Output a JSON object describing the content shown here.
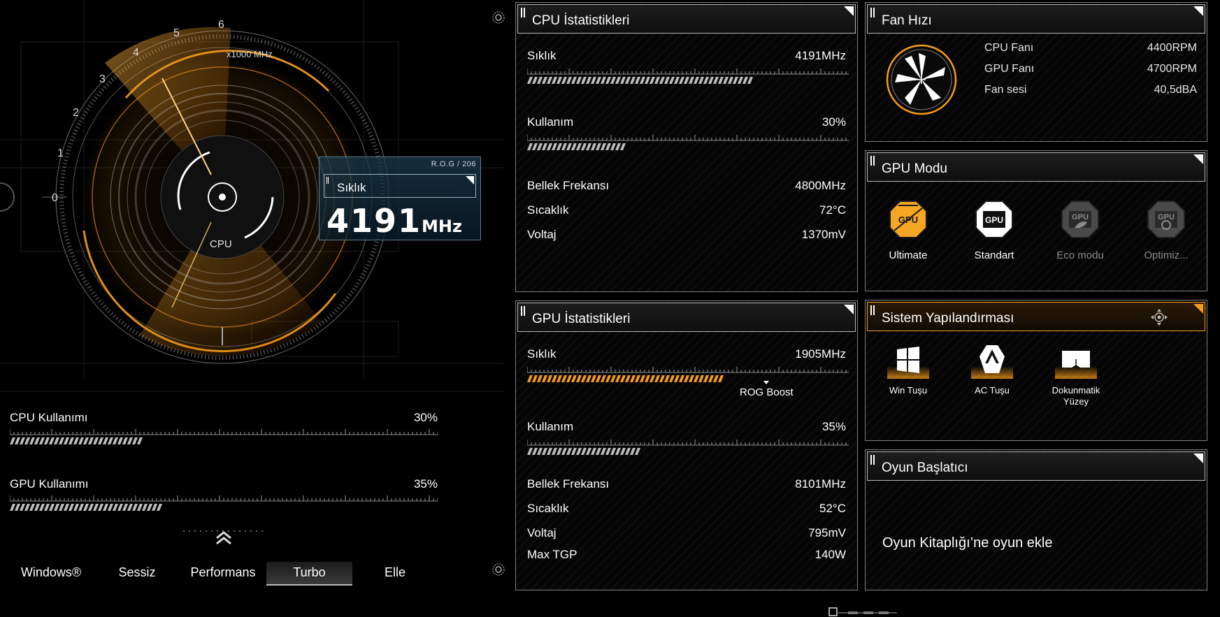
{
  "gauge": {
    "scale_label": "x1000 MHz",
    "ticks": [
      "0",
      "1",
      "2",
      "3",
      "4",
      "5",
      "6"
    ],
    "center_label": "CPU"
  },
  "freq_panel": {
    "badge": "R.O.G / 206",
    "label": "Sıklık",
    "value": "4191",
    "unit": "MHz"
  },
  "left_usage": [
    {
      "label": "CPU Kullanımı",
      "value": "30%",
      "fraction": 0.3
    },
    {
      "label": "GPU Kullanımı",
      "value": "35%",
      "fraction": 0.35
    }
  ],
  "modes": {
    "items": [
      "Windows®",
      "Sessiz",
      "Performans",
      "Turbo",
      "Elle"
    ],
    "active": "Turbo"
  },
  "cpu_stats": {
    "title": "CPU İstatistikleri",
    "freq": {
      "label": "Sıklık",
      "value": "4191MHz",
      "fraction": 0.7
    },
    "usage": {
      "label": "Kullanım",
      "value": "30%",
      "fraction": 0.3
    },
    "rows": [
      {
        "label": "Bellek Frekansı",
        "value": "4800MHz"
      },
      {
        "label": "Sıcaklık",
        "value": "72°C"
      },
      {
        "label": "Voltaj",
        "value": "1370mV"
      }
    ]
  },
  "gpu_stats": {
    "title": "GPU İstatistikleri",
    "freq": {
      "label": "Sıklık",
      "value": "1905MHz",
      "fraction": 0.6
    },
    "boost_label": "ROG Boost",
    "usage": {
      "label": "Kullanım",
      "value": "35%",
      "fraction": 0.35
    },
    "rows": [
      {
        "label": "Bellek Frekansı",
        "value": "8101MHz"
      },
      {
        "label": "Sıcaklık",
        "value": "52°C"
      },
      {
        "label": "Voltaj",
        "value": "795mV"
      },
      {
        "label": "Max TGP",
        "value": "140W"
      }
    ]
  },
  "fan": {
    "title": "Fan Hızı",
    "rows": [
      {
        "label": "CPU Fanı",
        "value": "4400RPM"
      },
      {
        "label": "GPU Fanı",
        "value": "4700RPM"
      },
      {
        "label": "Fan sesi",
        "value": "40,5dBA"
      }
    ]
  },
  "gpu_mode": {
    "title": "GPU Modu",
    "items": [
      {
        "label": "Ultimate",
        "state": "active"
      },
      {
        "label": "Standart",
        "state": "normal"
      },
      {
        "label": "Eco modu",
        "state": "disabled"
      },
      {
        "label": "Optimiz...",
        "state": "disabled"
      }
    ],
    "chip_text": "GPU"
  },
  "system_config": {
    "title": "Sistem Yapılandırması",
    "items": [
      {
        "label": "Win Tuşu"
      },
      {
        "label": "AC Tuşu"
      },
      {
        "label": "Dokunmatik Yüzey"
      }
    ]
  },
  "game_launcher": {
    "title": "Oyun Başlatıcı",
    "add_text": "Oyun Kitaplığı’ne oyun ekle"
  },
  "colors": {
    "accent": "#f59c1a",
    "panel_border": "#7f7f7f",
    "text": "#ffffff",
    "disabled": "#8a8a8a"
  }
}
